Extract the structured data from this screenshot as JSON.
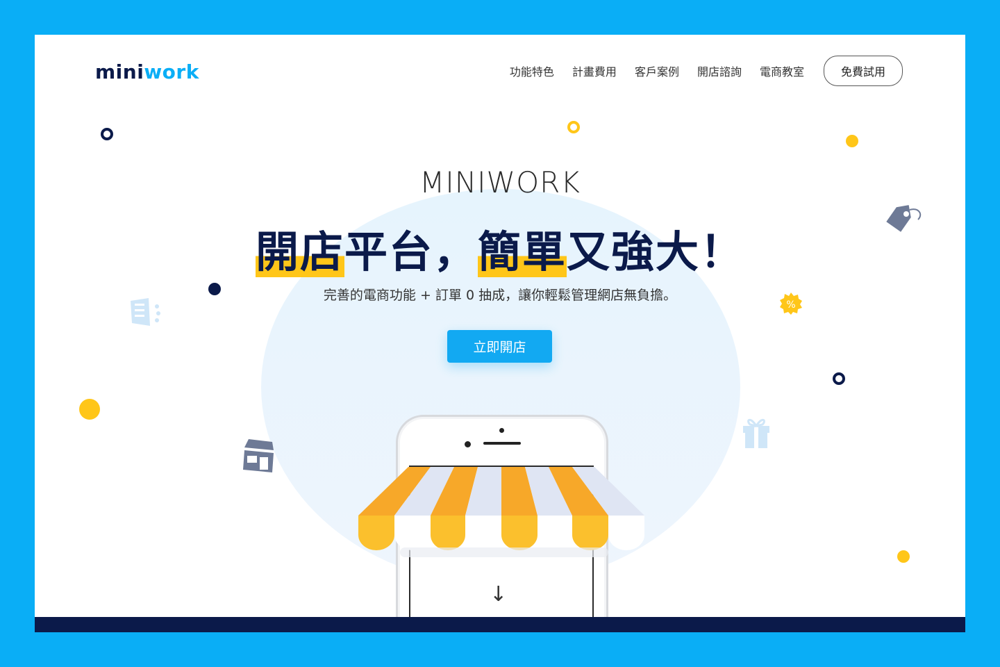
{
  "logo": {
    "text_main": "mini",
    "text_accent": "work"
  },
  "nav": {
    "items": [
      "功能特色",
      "計畫費用",
      "客戶案例",
      "開店諮詢",
      "電商教室"
    ],
    "trial_label": "免費試用"
  },
  "hero": {
    "brand": "MINIWORK",
    "headline_parts": [
      "開店",
      "平台，",
      "簡單",
      "又強大！"
    ],
    "subtitle": "完善的電商功能 + 訂單 0 抽成，讓你輕鬆管理網店無負擔。",
    "cta_label": "立即開店",
    "scroll_arrow": "↓"
  },
  "colors": {
    "frame": "#0aaef6",
    "navy": "#0b1a4a",
    "yellow": "#ffc619",
    "cta": "#12a9f2"
  },
  "icons": [
    "tag-icon",
    "discount-badge-icon",
    "gift-icon",
    "store-icon",
    "megaphone-icon"
  ]
}
